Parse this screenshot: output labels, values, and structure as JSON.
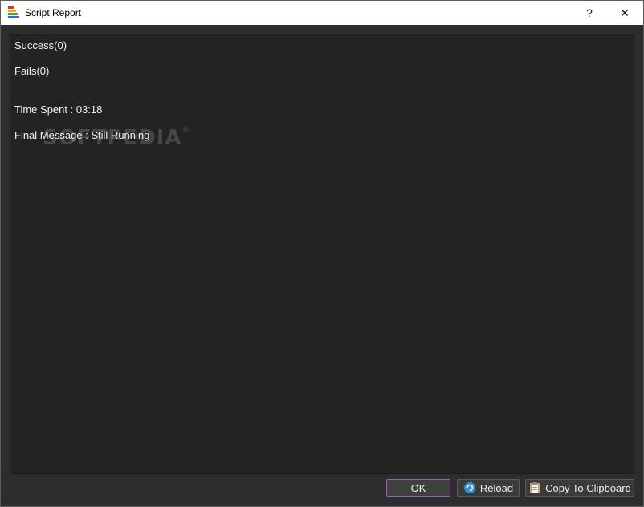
{
  "window": {
    "title": "Script Report",
    "help_glyph": "?",
    "close_glyph": "✕",
    "icon": "report-app-icon"
  },
  "report": {
    "success": "Success(0)",
    "fails": "Fails(0)",
    "time_spent": "Time Spent : 03:18",
    "final_message": "Final Message : Still Running",
    "watermark": "SOFTPEDIA",
    "watermark_mark": "®"
  },
  "buttons": {
    "ok": "OK",
    "reload": "Reload",
    "reload_icon": "refresh-icon",
    "copy": "Copy To Clipboard",
    "copy_icon": "clipboard-icon"
  },
  "colors": {
    "background": "#2d2d2d",
    "report_bg": "#232323",
    "text": "#f2f2f2",
    "ok_border": "#9a5fc0",
    "reload_icon": "#2f8fd8"
  }
}
